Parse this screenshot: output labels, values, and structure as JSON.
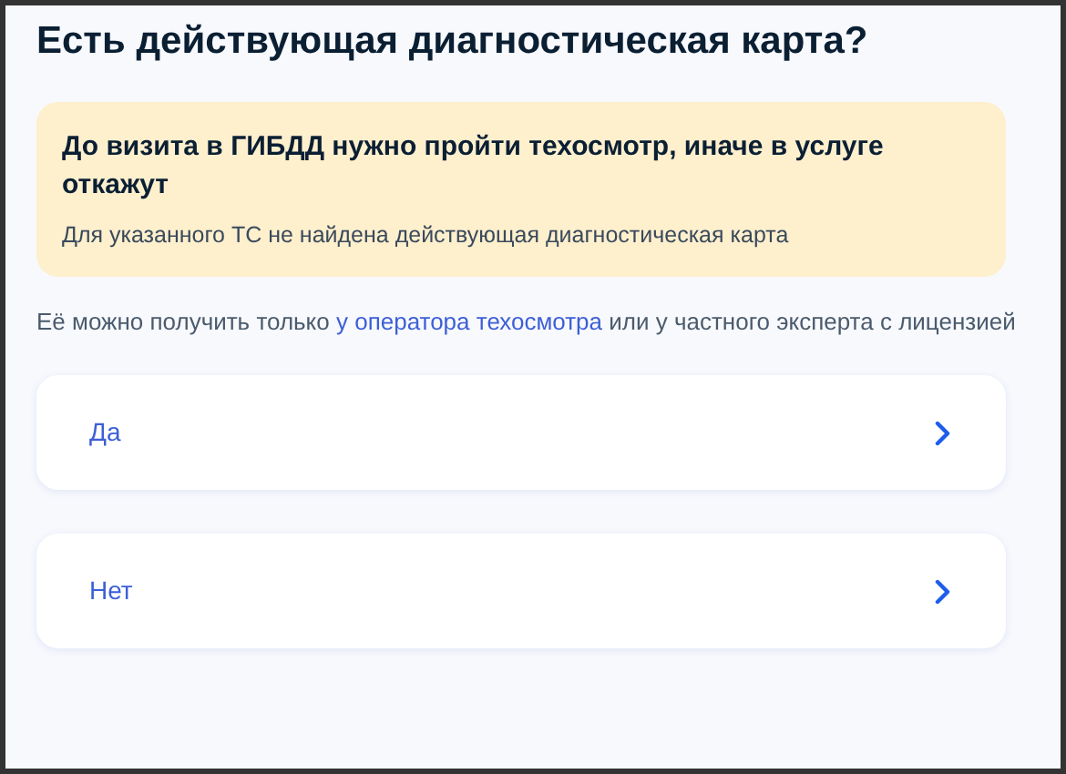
{
  "title": "Есть действующая диагностическая карта?",
  "alert": {
    "title": "До визита в ГИБДД нужно пройти техосмотр, иначе в услуге откажут",
    "text": "Для указанного ТС не найдена действующая диагностическая карта"
  },
  "note": {
    "before": "Её можно получить только",
    "link": "у оператора техосмотра",
    "after": "или у частного эксперта с лицензией"
  },
  "options": [
    {
      "label": "Да"
    },
    {
      "label": "Нет"
    }
  ]
}
